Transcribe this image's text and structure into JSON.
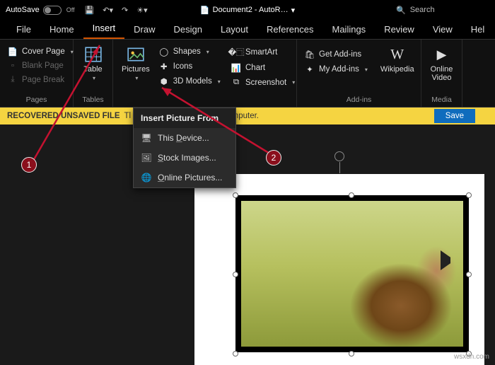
{
  "titlebar": {
    "autosave_label": "AutoSave",
    "autosave_state": "Off",
    "doc_title": "Document2 - AutoR…",
    "search_placeholder": "Search"
  },
  "tabs": [
    "File",
    "Home",
    "Insert",
    "Draw",
    "Design",
    "Layout",
    "References",
    "Mailings",
    "Review",
    "View",
    "Hel"
  ],
  "active_tab": "Insert",
  "ribbon": {
    "pages": {
      "label": "Pages",
      "cover_page": "Cover Page",
      "blank_page": "Blank Page",
      "page_break": "Page Break"
    },
    "tables": {
      "label": "Tables",
      "table": "Table"
    },
    "illustrations": {
      "pictures": "Pictures",
      "shapes": "Shapes",
      "icons": "Icons",
      "models": "3D Models"
    },
    "addins_col": {
      "smartart": "SmartArt",
      "chart": "Chart",
      "screenshot": "Screenshot"
    },
    "addins": {
      "label": "Add-ins",
      "get": "Get Add-ins",
      "my": "My Add-ins"
    },
    "wikipedia": "Wikipedia",
    "media": {
      "label": "Media",
      "online_video": "Online Video"
    }
  },
  "dropdown": {
    "header": "Insert Picture From",
    "items": [
      {
        "icon": "🖥",
        "label": "This Device..."
      },
      {
        "icon": "🖼",
        "label": "Stock Images..."
      },
      {
        "icon": "🌐",
        "label": "Online Pictures..."
      }
    ]
  },
  "messagebar": {
    "prefix": "RECOVERED UNSAVED FILE",
    "text": "Tl                                     mporarily stored on your computer.",
    "save": "Save"
  },
  "annotations": {
    "b1": "1",
    "b2": "2"
  },
  "watermark": "wsxdn.com"
}
